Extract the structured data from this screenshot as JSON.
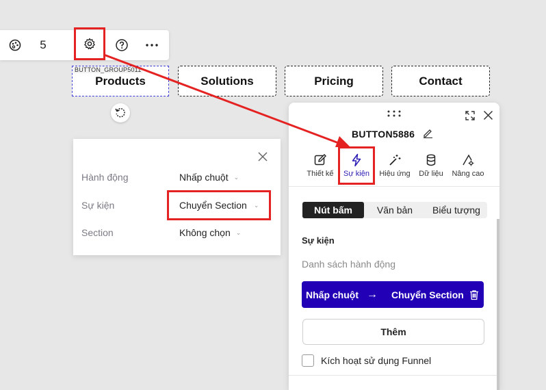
{
  "toolbar": {
    "count": "5",
    "icons": [
      "palette-icon",
      "gear-icon",
      "help-icon",
      "more-icon"
    ]
  },
  "canvas": {
    "group_label": "BUTTON_GROUP5011",
    "buttons": [
      "Products",
      "Solutions",
      "Pricing",
      "Contact"
    ]
  },
  "popup": {
    "rows": [
      {
        "label": "Hành động",
        "value": "Nhấp chuột"
      },
      {
        "label": "Sự kiện",
        "value": "Chuyển Section"
      },
      {
        "label": "Section",
        "value": "Không chọn"
      }
    ]
  },
  "panel": {
    "title": "BUTTON5886",
    "tabs": [
      {
        "label": "Thiết kế",
        "icon": "edit-icon"
      },
      {
        "label": "Sự kiện",
        "icon": "lightning-icon"
      },
      {
        "label": "Hiệu ứng",
        "icon": "magic-wand-icon"
      },
      {
        "label": "Dữ liệu",
        "icon": "database-icon"
      },
      {
        "label": "Nâng cao",
        "icon": "advanced-settings-icon"
      }
    ],
    "segments": [
      "Nút bấm",
      "Văn bản",
      "Biểu tượng"
    ],
    "section_title": "Sự kiện",
    "action_list_title": "Danh sách hành động",
    "action": {
      "trigger": "Nhấp chuột",
      "arrow": "→",
      "target": "Chuyển Section"
    },
    "add_label": "Thêm",
    "funnel_label": "Kích hoạt sử dụng Funnel"
  },
  "colors": {
    "accent": "#2200b5",
    "highlight": "#e52222",
    "selection": "#3b3bd6"
  }
}
